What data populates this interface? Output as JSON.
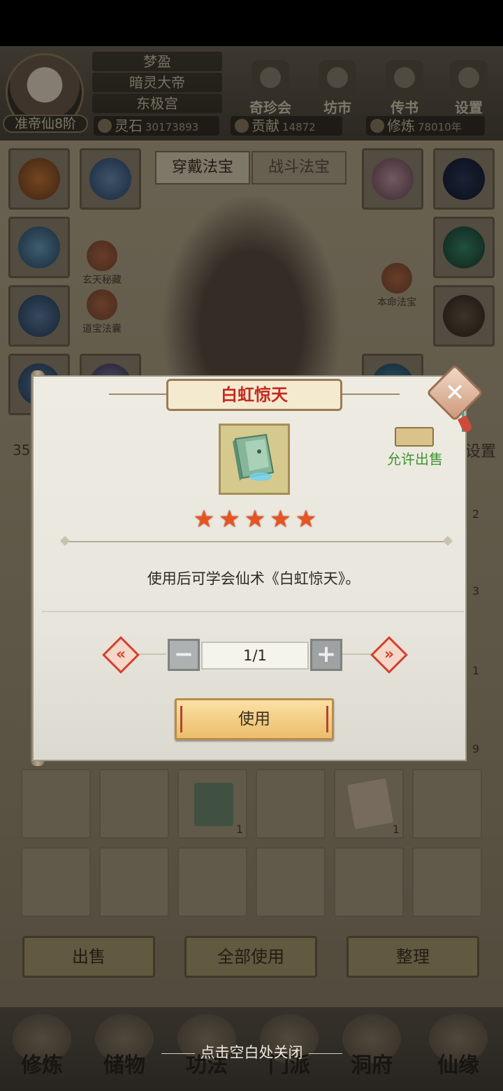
{
  "status_bar": {},
  "header": {
    "player_names": [
      "梦盈",
      "暗灵大帝",
      "东极宫"
    ],
    "rank": "准帝仙8阶",
    "menu": [
      {
        "label": "奇珍会",
        "icon": "treasure-pavilion-icon"
      },
      {
        "label": "坊市",
        "icon": "market-icon"
      },
      {
        "label": "传书",
        "icon": "letter-icon"
      },
      {
        "label": "设置",
        "icon": "settings-gear-icon"
      }
    ],
    "resources": [
      {
        "label": "灵石",
        "value": "30173893"
      },
      {
        "label": "贡献",
        "value": "14872"
      },
      {
        "label": "修炼",
        "value": "78010年"
      }
    ]
  },
  "equipment": {
    "tabs": [
      "穿戴法宝",
      "战斗法宝"
    ],
    "side_buttons": [
      "玄天秘藏",
      "道宝法囊",
      "本命法宝"
    ],
    "partial_left": "35",
    "partial_right": "设置"
  },
  "bag": {
    "counts": [
      "2",
      "3",
      "1",
      "9",
      "1",
      "1"
    ],
    "buttons": [
      "出售",
      "全部使用",
      "整理"
    ]
  },
  "nav": [
    "修炼",
    "储物",
    "功法",
    "门派",
    "洞府",
    "仙缘"
  ],
  "dialog": {
    "title": "白虹惊天",
    "sell_label": "允许出售",
    "stars": 5,
    "description": "使用后可学会仙术《白虹惊天》。",
    "quantity": "1/1",
    "use_label": "使用",
    "prev_icon": "«",
    "next_icon": "»",
    "minus": "−",
    "plus": "+",
    "close_icon": "✕"
  },
  "close_hint": "点击空白处关闭",
  "colors": {
    "title_red": "#c6281e",
    "sell_green": "#3f9532",
    "star_orange": "#e8531f",
    "use_button": "#f0c978"
  }
}
